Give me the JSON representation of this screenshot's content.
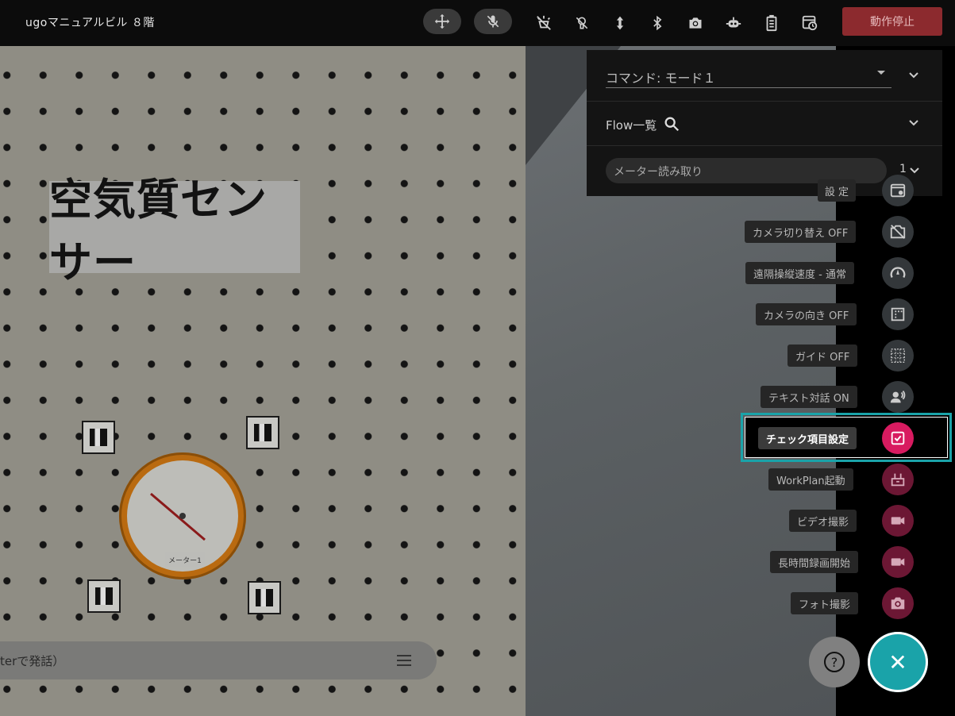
{
  "header": {
    "title": "ugoマニュアルビル ８階",
    "stop_label": "動作停止",
    "icons": [
      "move-icon",
      "mic-off-icon",
      "light-off-icon",
      "pin-off-icon",
      "vertical-arrows-icon",
      "bluetooth-icon",
      "camera-icon",
      "robot-icon",
      "battery-icon",
      "history-icon"
    ]
  },
  "camera": {
    "sign_text": "空気質センサー",
    "gauge_label": "メーター1",
    "chat_placeholder": "terで発話）"
  },
  "panel": {
    "command_label": "コマンド: モード１",
    "flow_label": "Flow一覧",
    "flow_input_value": "メーター読み取り",
    "flow_count": "1"
  },
  "actions": [
    {
      "label": "設 定",
      "icon": "settings-icon",
      "style": "gray"
    },
    {
      "label": "カメラ切り替え OFF",
      "icon": "camera-switch-off-icon",
      "style": "gray"
    },
    {
      "label": "遠隔操縦速度 - 通常",
      "icon": "speed-icon",
      "style": "gray"
    },
    {
      "label": "カメラの向き OFF",
      "icon": "camera-direction-icon",
      "style": "gray"
    },
    {
      "label": "ガイド OFF",
      "icon": "grid-guide-icon",
      "style": "gray"
    },
    {
      "label": "テキスト対話 ON",
      "icon": "voice-chat-icon",
      "style": "gray"
    },
    {
      "label": "チェック項目設定",
      "icon": "checklist-icon",
      "style": "hot"
    },
    {
      "label": "WorkPlan起動",
      "icon": "workplan-icon",
      "style": "pink"
    },
    {
      "label": "ビデオ撮影",
      "icon": "video-icon",
      "style": "pink"
    },
    {
      "label": "長時間録画開始",
      "icon": "long-record-icon",
      "style": "pink"
    },
    {
      "label": "フォト撮影",
      "icon": "photo-icon",
      "style": "pink"
    }
  ],
  "help_glyph": "?",
  "close_glyph": "✕"
}
